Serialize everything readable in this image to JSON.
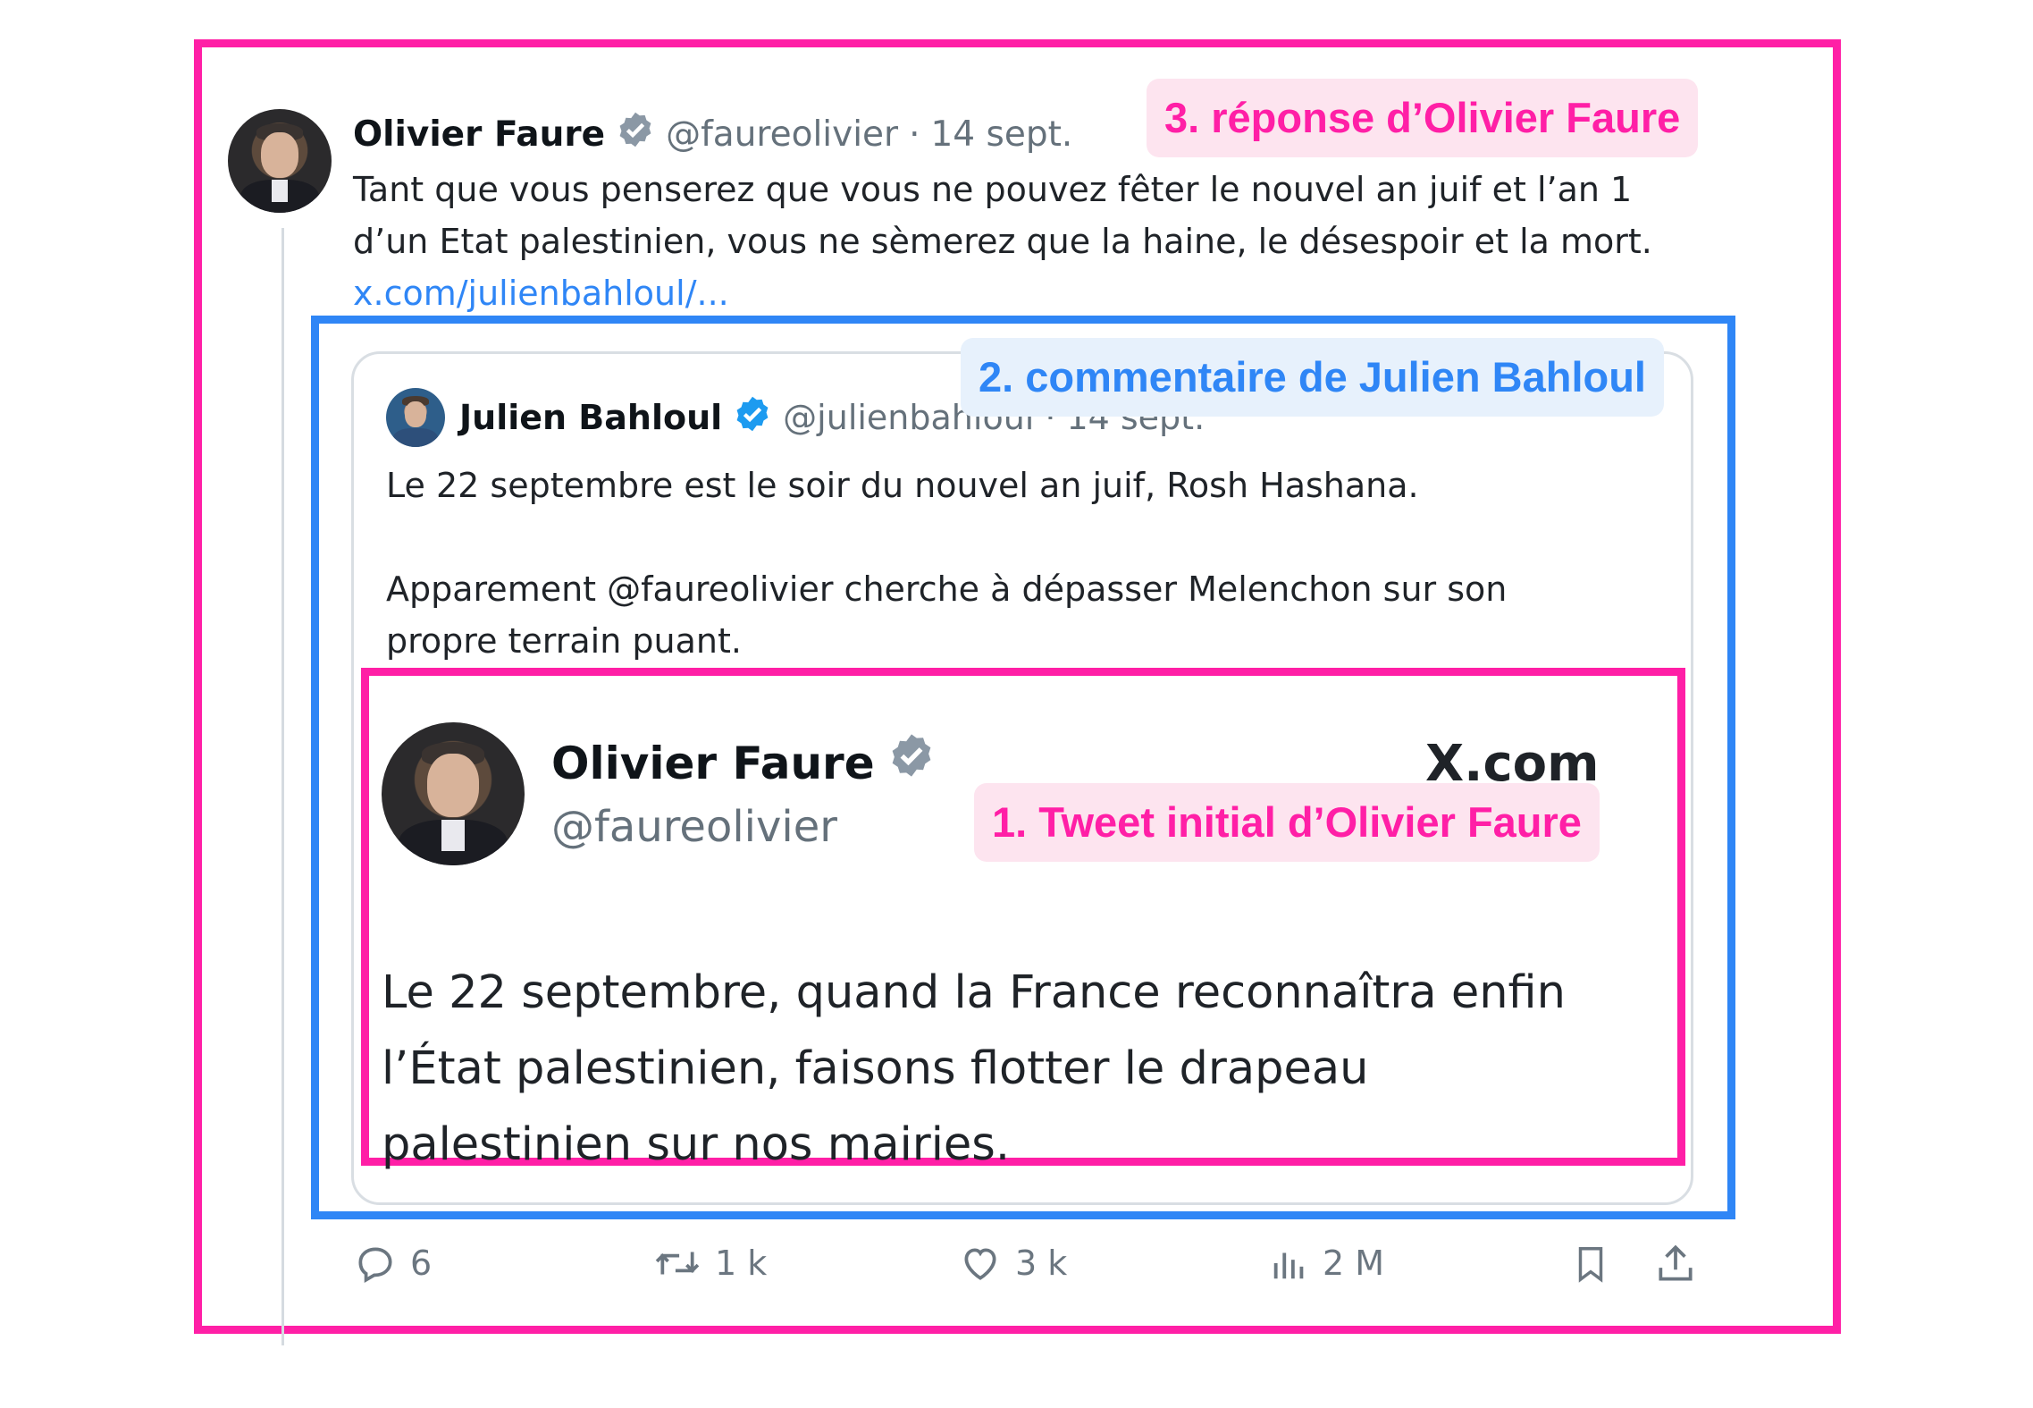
{
  "labels": {
    "reply": "3. réponse d’Olivier Faure",
    "comment": "2. commentaire de Julien Bahloul",
    "initial": "1. Tweet initial d’Olivier Faure"
  },
  "reply_tweet": {
    "author_name": "Olivier Faure",
    "handle": "@faureolivier",
    "date_sep": "·",
    "date": "14 sept.",
    "text_line1": "Tant que vous penserez que vous ne pouvez fêter le nouvel an juif et l’an 1",
    "text_line2": "d’un Etat palestinien, vous ne sèmerez que la haine, le désespoir et la mort.",
    "link": "x.com/julienbahloul/..."
  },
  "quoted_tweet": {
    "author_name": "Julien Bahloul",
    "handle": "@julienbahloul",
    "date_sep": "·",
    "date": "14 sept.",
    "line1": "Le 22 septembre est le soir du nouvel an juif, Rosh Hashana.",
    "line2": "Apparement @faureolivier cherche à dépasser Melenchon sur son",
    "line3": "propre terrain puant."
  },
  "screenshot_tweet": {
    "author_name": "Olivier Faure",
    "handle": "@faureolivier",
    "brand": "X.com",
    "line1": "Le 22 septembre, quand la France reconnaîtra enfin",
    "line2": "l’État palestinien, faisons flotter le drapeau",
    "line3": "palestinien sur nos mairies."
  },
  "actions": {
    "replies": "6",
    "reposts": "1 k",
    "likes": "3 k",
    "views": "2 M"
  },
  "icons": [
    "verified-badge-icon",
    "reply-icon",
    "repost-icon",
    "like-icon",
    "views-icon",
    "bookmark-icon",
    "share-icon",
    "x-logo-icon"
  ],
  "colors": {
    "annotation_pink": "#ff1fa6",
    "annotation_blue": "#2f86f6",
    "verified_grey": "#8b98a5",
    "verified_blue": "#1d9bf0",
    "link_blue": "#2f86f6"
  }
}
